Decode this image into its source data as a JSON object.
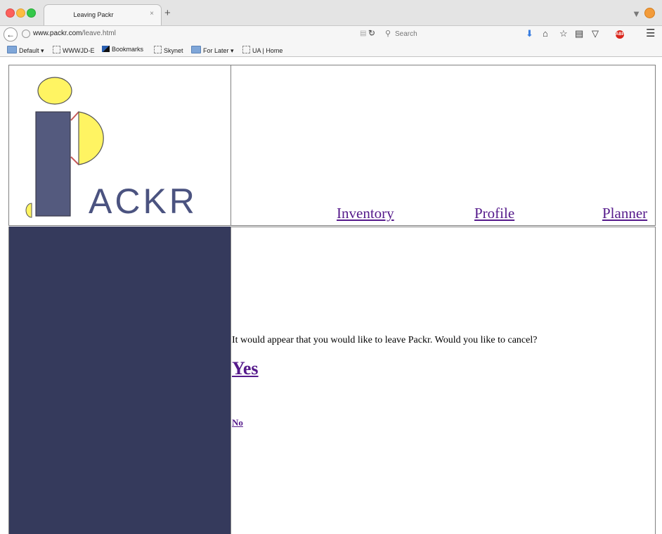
{
  "browser": {
    "tab_title": "Leaving Packr",
    "tab_close": "×",
    "new_tab": "+",
    "url_host": "www.packr.com",
    "url_path": "/leave.html",
    "search_placeholder": "Search",
    "addon_label": "ABP",
    "toolbar_icons": [
      "download-icon",
      "home-icon",
      "star-icon",
      "clipboard-icon",
      "pocket-icon",
      "adblock-icon",
      "menu-icon"
    ]
  },
  "bookmarks": [
    {
      "label": "Default",
      "icon": "folder-icon",
      "dropdown": true
    },
    {
      "label": "WWWJD-E",
      "icon": "page-icon",
      "dropdown": false
    },
    {
      "label": "Bookmarks",
      "icon": "blocks-icon",
      "dropdown": false
    },
    {
      "label": "Skynet",
      "icon": "page-icon",
      "dropdown": false
    },
    {
      "label": "For Later",
      "icon": "folder-icon",
      "dropdown": true
    },
    {
      "label": "UA | Home",
      "icon": "page-icon",
      "dropdown": false
    }
  ],
  "logo": {
    "text": "ACKR",
    "colors": {
      "yellow": "#fff462",
      "navy": "#545a7e",
      "red": "#c65a5a"
    }
  },
  "nav": {
    "inventory": "Inventory",
    "profile": "Profile",
    "planner": "Planner"
  },
  "main": {
    "message": "It would appear that you would like to leave Packr. Would you like to cancel?",
    "yes": "Yes",
    "no": "No"
  },
  "colors": {
    "sidebar": "#353a5c",
    "link_visited": "#551a8b"
  }
}
